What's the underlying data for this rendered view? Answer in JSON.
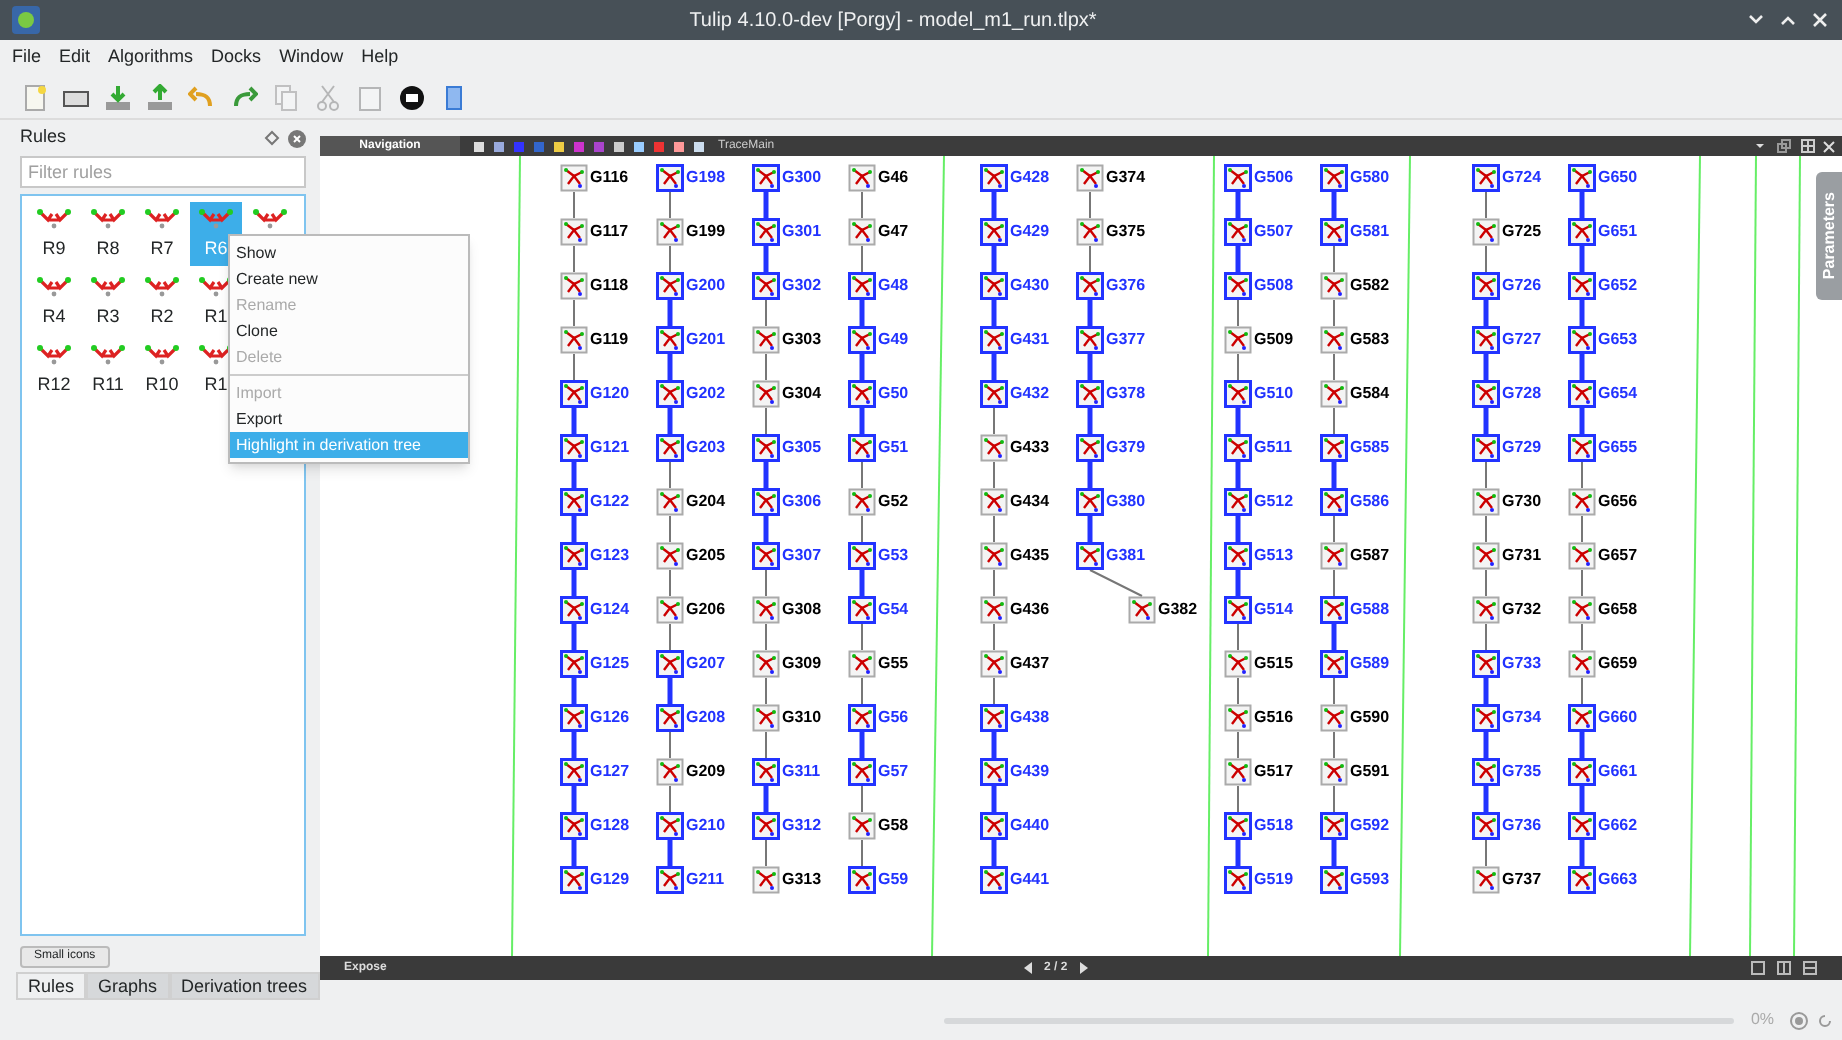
{
  "window": {
    "title": "Tulip 4.10.0-dev [Porgy] - model_m1_run.tlpx*"
  },
  "menu": [
    "File",
    "Edit",
    "Algorithms",
    "Docks",
    "Window",
    "Help"
  ],
  "toolbar": [
    {
      "kind": "new",
      "disabled": false
    },
    {
      "kind": "open",
      "disabled": false
    },
    {
      "kind": "import",
      "disabled": false
    },
    {
      "kind": "export",
      "disabled": false
    },
    {
      "kind": "undo",
      "disabled": false
    },
    {
      "kind": "redo",
      "disabled": false
    },
    {
      "kind": "copy",
      "disabled": true
    },
    {
      "kind": "cut",
      "disabled": true
    },
    {
      "kind": "paste",
      "disabled": true
    },
    {
      "kind": "camera",
      "disabled": false
    },
    {
      "kind": "help",
      "disabled": false
    }
  ],
  "rules_dock": {
    "title": "Rules",
    "filter": {
      "placeholder": "Filter rules"
    },
    "rule_rows": [
      [
        {
          "label": "R9",
          "selected": false
        },
        {
          "label": "R8",
          "selected": false
        },
        {
          "label": "R7",
          "selected": false
        },
        {
          "label": "R6",
          "selected": true
        },
        {
          "selected": false
        }
      ],
      [
        {
          "label": "R4",
          "selected": false
        },
        {
          "label": "R3",
          "selected": false
        },
        {
          "label": "R2",
          "selected": false
        },
        {
          "label": "R1",
          "selected": false
        }
      ],
      [
        {
          "label": "R12",
          "selected": false
        },
        {
          "label": "R11",
          "selected": false
        },
        {
          "label": "R10",
          "selected": false
        },
        {
          "label": "R1",
          "selected": false
        }
      ]
    ],
    "small_icons_button": "Small icons",
    "tabs": [
      {
        "label": "Rules",
        "selected": true
      },
      {
        "label": "Graphs",
        "selected": false
      },
      {
        "label": "Derivation trees",
        "selected": false
      }
    ]
  },
  "context_menu": [
    {
      "kind": "item",
      "label": "Show",
      "disabled": false,
      "selected": false
    },
    {
      "kind": "item",
      "label": "Create new",
      "disabled": false,
      "selected": false
    },
    {
      "kind": "item",
      "label": "Rename",
      "disabled": true,
      "selected": false
    },
    {
      "kind": "item",
      "label": "Clone",
      "disabled": false,
      "selected": false
    },
    {
      "kind": "item",
      "label": "Delete",
      "disabled": true,
      "selected": false
    },
    {
      "kind": "separator"
    },
    {
      "kind": "item",
      "label": "Import",
      "disabled": true,
      "selected": false
    },
    {
      "kind": "item",
      "label": "Export",
      "disabled": false,
      "selected": false
    },
    {
      "kind": "item",
      "label": "Highlight in derivation tree",
      "disabled": false,
      "selected": true
    }
  ],
  "view": {
    "navigation": "Navigation",
    "title": "TraceMain",
    "footer": "Expose",
    "page": "2 / 2",
    "side_tab": "Parameters"
  },
  "graph": {
    "columns": [
      {
        "nodes": [
          {
            "label": "G116",
            "highlighted": false
          },
          {
            "label": "G117",
            "highlighted": false
          },
          {
            "label": "G118",
            "highlighted": false
          },
          {
            "label": "G119",
            "highlighted": false
          },
          {
            "label": "G120",
            "highlighted": true
          },
          {
            "label": "G121",
            "highlighted": true
          },
          {
            "label": "G122",
            "highlighted": true
          },
          {
            "label": "G123",
            "highlighted": true
          },
          {
            "label": "G124",
            "highlighted": true
          },
          {
            "label": "G125",
            "highlighted": true
          },
          {
            "label": "G126",
            "highlighted": true
          },
          {
            "label": "G127",
            "highlighted": true
          },
          {
            "label": "G128",
            "highlighted": true
          },
          {
            "label": "G129",
            "highlighted": true
          }
        ]
      },
      {
        "nodes": [
          {
            "label": "G198",
            "highlighted": true
          },
          {
            "label": "G199",
            "highlighted": false
          },
          {
            "label": "G200",
            "highlighted": true
          },
          {
            "label": "G201",
            "highlighted": true
          },
          {
            "label": "G202",
            "highlighted": true
          },
          {
            "label": "G203",
            "highlighted": true
          },
          {
            "label": "G204",
            "highlighted": false
          },
          {
            "label": "G205",
            "highlighted": false
          },
          {
            "label": "G206",
            "highlighted": false
          },
          {
            "label": "G207",
            "highlighted": true
          },
          {
            "label": "G208",
            "highlighted": true
          },
          {
            "label": "G209",
            "highlighted": false
          },
          {
            "label": "G210",
            "highlighted": true
          },
          {
            "label": "G211",
            "highlighted": true
          }
        ]
      },
      {
        "nodes": [
          {
            "label": "G300",
            "highlighted": true
          },
          {
            "label": "G301",
            "highlighted": true
          },
          {
            "label": "G302",
            "highlighted": true
          },
          {
            "label": "G303",
            "highlighted": false
          },
          {
            "label": "G304",
            "highlighted": false
          },
          {
            "label": "G305",
            "highlighted": true
          },
          {
            "label": "G306",
            "highlighted": true
          },
          {
            "label": "G307",
            "highlighted": true
          },
          {
            "label": "G308",
            "highlighted": false
          },
          {
            "label": "G309",
            "highlighted": false
          },
          {
            "label": "G310",
            "highlighted": false
          },
          {
            "label": "G311",
            "highlighted": true
          },
          {
            "label": "G312",
            "highlighted": true
          },
          {
            "label": "G313",
            "highlighted": false
          }
        ]
      },
      {
        "nodes": [
          {
            "label": "G46",
            "highlighted": false
          },
          {
            "label": "G47",
            "highlighted": false
          },
          {
            "label": "G48",
            "highlighted": true
          },
          {
            "label": "G49",
            "highlighted": true
          },
          {
            "label": "G50",
            "highlighted": true
          },
          {
            "label": "G51",
            "highlighted": true
          },
          {
            "label": "G52",
            "highlighted": false
          },
          {
            "label": "G53",
            "highlighted": true
          },
          {
            "label": "G54",
            "highlighted": true
          },
          {
            "label": "G55",
            "highlighted": false
          },
          {
            "label": "G56",
            "highlighted": true
          },
          {
            "label": "G57",
            "highlighted": true
          },
          {
            "label": "G58",
            "highlighted": false
          },
          {
            "label": "G59",
            "highlighted": true
          }
        ]
      },
      {
        "nodes": [
          {
            "label": "G428",
            "highlighted": true
          },
          {
            "label": "G429",
            "highlighted": true
          },
          {
            "label": "G430",
            "highlighted": true
          },
          {
            "label": "G431",
            "highlighted": true
          },
          {
            "label": "G432",
            "highlighted": true
          },
          {
            "label": "G433",
            "highlighted": false
          },
          {
            "label": "G434",
            "highlighted": false
          },
          {
            "label": "G435",
            "highlighted": false
          },
          {
            "label": "G436",
            "highlighted": false
          },
          {
            "label": "G437",
            "highlighted": false
          },
          {
            "label": "G438",
            "highlighted": true
          },
          {
            "label": "G439",
            "highlighted": true
          },
          {
            "label": "G440",
            "highlighted": true
          },
          {
            "label": "G441",
            "highlighted": true
          }
        ]
      },
      {
        "nodes": [
          {
            "label": "G374",
            "highlighted": false
          },
          {
            "label": "G375",
            "highlighted": false
          },
          {
            "label": "G376",
            "highlighted": true
          },
          {
            "label": "G377",
            "highlighted": true
          },
          {
            "label": "G378",
            "highlighted": true
          },
          {
            "label": "G379",
            "highlighted": true
          },
          {
            "label": "G380",
            "highlighted": true
          },
          {
            "label": "G381",
            "highlighted": true
          },
          {
            "label": "G382",
            "highlighted": false,
            "kind": "branch"
          }
        ]
      },
      {
        "nodes": [
          {
            "label": "G506",
            "highlighted": true
          },
          {
            "label": "G507",
            "highlighted": true
          },
          {
            "label": "G508",
            "highlighted": true
          },
          {
            "label": "G509",
            "highlighted": false
          },
          {
            "label": "G510",
            "highlighted": true
          },
          {
            "label": "G511",
            "highlighted": true
          },
          {
            "label": "G512",
            "highlighted": true
          },
          {
            "label": "G513",
            "highlighted": true
          },
          {
            "label": "G514",
            "highlighted": true
          },
          {
            "label": "G515",
            "highlighted": false
          },
          {
            "label": "G516",
            "highlighted": false
          },
          {
            "label": "G517",
            "highlighted": false
          },
          {
            "label": "G518",
            "highlighted": true
          },
          {
            "label": "G519",
            "highlighted": true
          }
        ]
      },
      {
        "nodes": [
          {
            "label": "G580",
            "highlighted": true
          },
          {
            "label": "G581",
            "highlighted": true
          },
          {
            "label": "G582",
            "highlighted": false
          },
          {
            "label": "G583",
            "highlighted": false
          },
          {
            "label": "G584",
            "highlighted": false
          },
          {
            "label": "G585",
            "highlighted": true
          },
          {
            "label": "G586",
            "highlighted": true
          },
          {
            "label": "G587",
            "highlighted": false
          },
          {
            "label": "G588",
            "highlighted": true
          },
          {
            "label": "G589",
            "highlighted": true
          },
          {
            "label": "G590",
            "highlighted": false
          },
          {
            "label": "G591",
            "highlighted": false
          },
          {
            "label": "G592",
            "highlighted": true
          },
          {
            "label": "G593",
            "highlighted": true
          }
        ]
      },
      {
        "nodes": [
          {
            "label": "G724",
            "highlighted": true
          },
          {
            "label": "G725",
            "highlighted": false
          },
          {
            "label": "G726",
            "highlighted": true
          },
          {
            "label": "G727",
            "highlighted": true
          },
          {
            "label": "G728",
            "highlighted": true
          },
          {
            "label": "G729",
            "highlighted": true
          },
          {
            "label": "G730",
            "highlighted": false
          },
          {
            "label": "G731",
            "highlighted": false
          },
          {
            "label": "G732",
            "highlighted": false
          },
          {
            "label": "G733",
            "highlighted": true
          },
          {
            "label": "G734",
            "highlighted": true
          },
          {
            "label": "G735",
            "highlighted": true
          },
          {
            "label": "G736",
            "highlighted": true
          },
          {
            "label": "G737",
            "highlighted": false
          }
        ]
      },
      {
        "nodes": [
          {
            "label": "G650",
            "highlighted": true
          },
          {
            "label": "G651",
            "highlighted": true
          },
          {
            "label": "G652",
            "highlighted": true
          },
          {
            "label": "G653",
            "highlighted": true
          },
          {
            "label": "G654",
            "highlighted": true
          },
          {
            "label": "G655",
            "highlighted": true
          },
          {
            "label": "G656",
            "highlighted": false
          },
          {
            "label": "G657",
            "highlighted": false
          },
          {
            "label": "G658",
            "highlighted": false
          },
          {
            "label": "G659",
            "highlighted": false
          },
          {
            "label": "G660",
            "highlighted": true
          },
          {
            "label": "G661",
            "highlighted": true
          },
          {
            "label": "G662",
            "highlighted": true
          },
          {
            "label": "G663",
            "highlighted": true
          }
        ]
      }
    ]
  },
  "status": {
    "progress": {
      "level": 0,
      "reading": "0%"
    }
  }
}
